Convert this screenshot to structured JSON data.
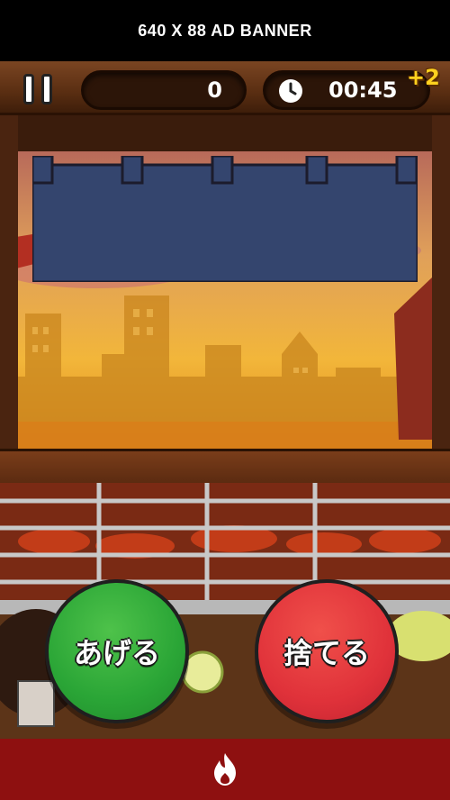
{
  "ad_banner": {
    "label": "640 X 88 AD BANNER"
  },
  "hud": {
    "score": "0",
    "timer": "00:45",
    "time_bonus": "+2",
    "icons": {
      "pause": "pause-icon",
      "clock": "clock-icon"
    }
  },
  "actions": {
    "grill_button": "あげる",
    "discard_button": "捨てる"
  },
  "footer": {
    "icon": "flame-icon"
  },
  "colors": {
    "grill_button": "#2aa536",
    "discard_button": "#e0323a",
    "footer": "#8e1010",
    "bonus": "#ffd21f"
  }
}
